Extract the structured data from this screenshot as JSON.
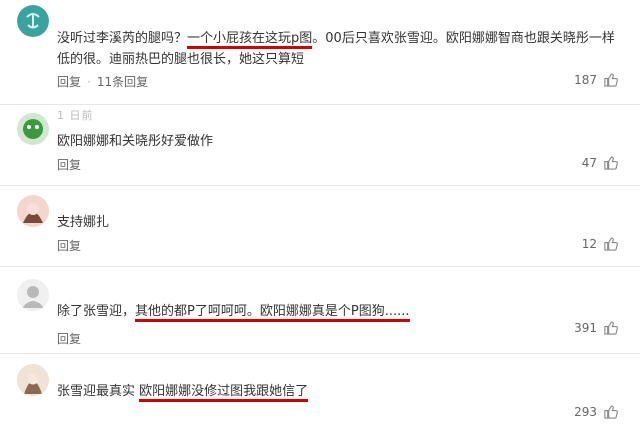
{
  "comments": [
    {
      "text_before": "没听过李溪芮的腿吗？",
      "text_underlined": "一个小屁孩在这玩p图",
      "text_after": "。00后只喜欢张雪迎。欧阳娜娜智商也跟关晓彤一样低的很。迪丽热巴的腿也很长，她这只算短",
      "reply_label": "回复",
      "reply_count": "11条回复",
      "likes": "187",
      "avatar_colors": [
        "#3aa3a0",
        "#d7f1ef"
      ]
    },
    {
      "meta": "1 日前",
      "text": "欧阳娜娜和关晓彤好爱做作",
      "reply_label": "回复",
      "likes": "47",
      "avatar_colors": [
        "#3c9a3c",
        "#cfe8cf"
      ]
    },
    {
      "text": "支持娜扎",
      "reply_label": "回复",
      "likes": "12",
      "avatar_colors": [
        "#7a4a3a",
        "#f3d6cc"
      ]
    },
    {
      "text_before": "除了张雪迎，",
      "text_underlined": "其他的都P了呵呵呵。欧阳娜娜真是个P图狗......",
      "reply_label": "回复",
      "likes": "391",
      "avatar_colors": [
        "#b9b9b9",
        "#f0f0f0"
      ]
    },
    {
      "text_before": "张雪迎最真实 ",
      "text_underlined": "欧阳娜娜没修过图我跟她信了",
      "likes": "293",
      "avatar_colors": [
        "#8a6a50",
        "#efe2d6"
      ]
    }
  ],
  "icons": {
    "thumb": "thumbs-up-icon",
    "accent": "#d40000"
  }
}
